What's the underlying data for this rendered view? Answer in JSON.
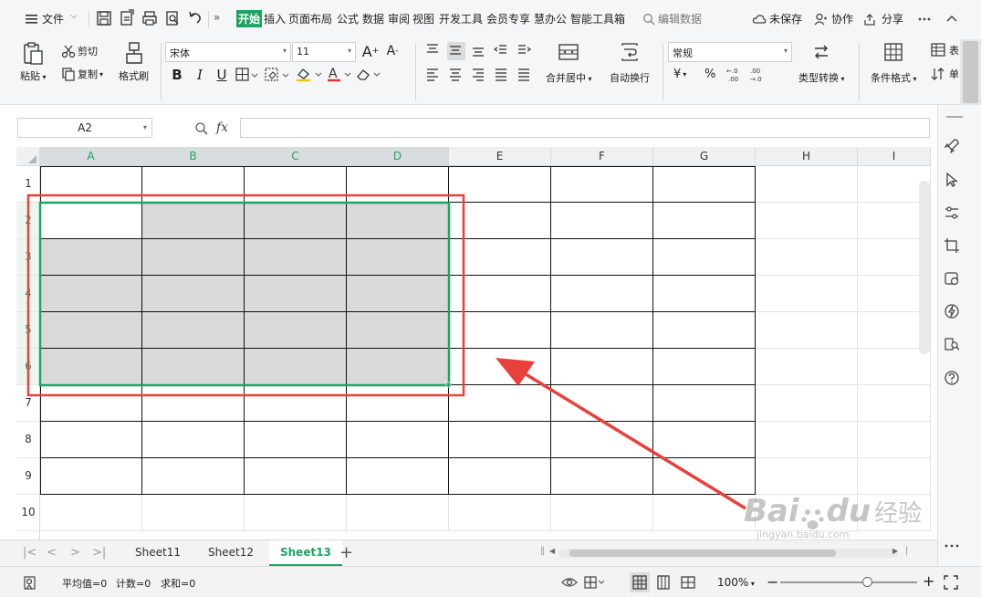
{
  "menubar": {
    "file_label": "文件",
    "tabs": [
      {
        "label": "开始",
        "active": true
      },
      {
        "label": "插入"
      },
      {
        "label": "页面布局"
      },
      {
        "label": "公式"
      },
      {
        "label": "数据"
      },
      {
        "label": "审阅"
      },
      {
        "label": "视图"
      },
      {
        "label": "开发工具"
      },
      {
        "label": "会员专享"
      },
      {
        "label": "慧办公"
      },
      {
        "label": "智能工具箱"
      }
    ],
    "more": "»",
    "search_label": "编辑数据",
    "unsaved_label": "未保存",
    "collab_label": "协作",
    "share_label": "分享"
  },
  "ribbon": {
    "paste": "粘贴",
    "cut": "剪切",
    "copy": "复制",
    "format_painter": "格式刷",
    "font_name": "宋体",
    "font_size": "11",
    "bold": "B",
    "italic": "I",
    "underline": "U",
    "merge_center": "合并居中",
    "wrap_text": "自动换行",
    "number_format": "常规",
    "currency": "¥",
    "percent": "%",
    "dec_inc": "⁺.0 .00",
    "dec_dec": ".00 ⁺.0",
    "type_convert": "类型转换",
    "conditional_format": "条件格式",
    "table_style": "表",
    "single": "单"
  },
  "formula_bar": {
    "name_box": "A2",
    "fx": "fx",
    "value": ""
  },
  "grid": {
    "columns": [
      "A",
      "B",
      "C",
      "D",
      "E",
      "F",
      "G",
      "H",
      "I"
    ],
    "rows": [
      "1",
      "2",
      "3",
      "4",
      "5",
      "6",
      "7",
      "8",
      "9",
      "10"
    ],
    "selected_cols": [
      "A",
      "B",
      "C",
      "D"
    ],
    "selected_rows": [
      "2",
      "3",
      "4",
      "5",
      "6"
    ],
    "active_cell": "A2",
    "selection_range": "A2:D6"
  },
  "sheets": {
    "tabs": [
      {
        "label": "Sheet11"
      },
      {
        "label": "Sheet12"
      },
      {
        "label": "Sheet13",
        "active": true
      }
    ],
    "add": "+"
  },
  "statusbar": {
    "average": "平均值=0",
    "count": "计数=0",
    "sum": "求和=0",
    "zoom": "100%",
    "zoom_minus": "−",
    "zoom_plus": "+",
    "zoom_level": 0.64
  },
  "watermark": {
    "brand_left": "Bai",
    "brand_right": "du",
    "cn": "经验",
    "url": "jingyan.baidu.com"
  },
  "colors": {
    "accent": "#1fa362",
    "selection_fill": "#d9d9d9",
    "annotation": "#e8403a",
    "menubar_bg": "#f5f6f7"
  }
}
